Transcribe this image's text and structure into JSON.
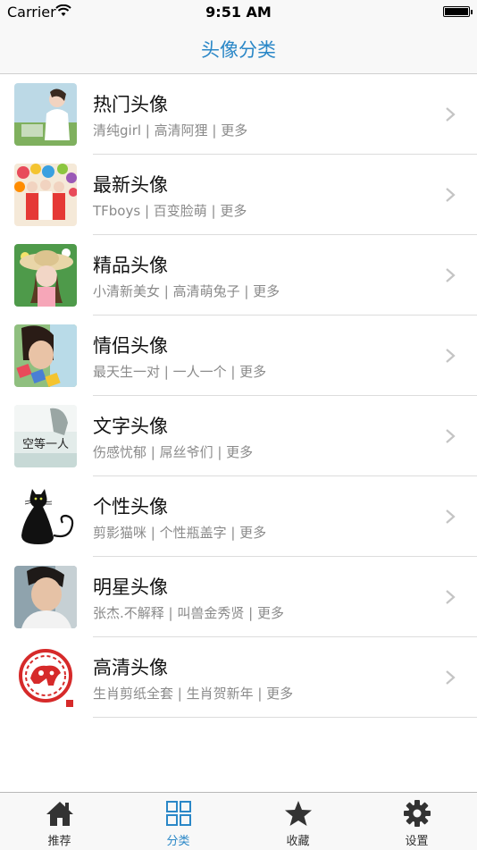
{
  "status_bar": {
    "carrier": "Carrier",
    "time": "9:51 AM"
  },
  "nav": {
    "title": "头像分类"
  },
  "categories": [
    {
      "title": "热门头像",
      "subtitle": "清纯girl | 高清阿狸 | 更多"
    },
    {
      "title": "最新头像",
      "subtitle": "TFboys | 百变脸萌 | 更多"
    },
    {
      "title": "精品头像",
      "subtitle": "小清新美女 | 高清萌兔子 | 更多"
    },
    {
      "title": "情侣头像",
      "subtitle": "最天生一对 | 一人一个 | 更多"
    },
    {
      "title": "文字头像",
      "subtitle": "伤感忧郁 | 屌丝爷们 | 更多"
    },
    {
      "title": "个性头像",
      "subtitle": "剪影猫咪 | 个性瓶盖字 | 更多"
    },
    {
      "title": "明星头像",
      "subtitle": "张杰.不解释 | 叫兽金秀贤 | 更多"
    },
    {
      "title": "高清头像",
      "subtitle": "生肖剪纸全套 | 生肖贺新年 | 更多"
    }
  ],
  "thumb_text": {
    "text_avatar": "空等一人"
  },
  "tabs": [
    {
      "label": "推荐",
      "icon": "home-icon"
    },
    {
      "label": "分类",
      "icon": "grid-icon"
    },
    {
      "label": "收藏",
      "icon": "star-icon"
    },
    {
      "label": "设置",
      "icon": "gear-icon"
    }
  ],
  "colors": {
    "accent": "#2a87c7",
    "nav_background": "#f8f8f8",
    "subtitle": "#8a8a8a"
  },
  "active_tab": "分类"
}
